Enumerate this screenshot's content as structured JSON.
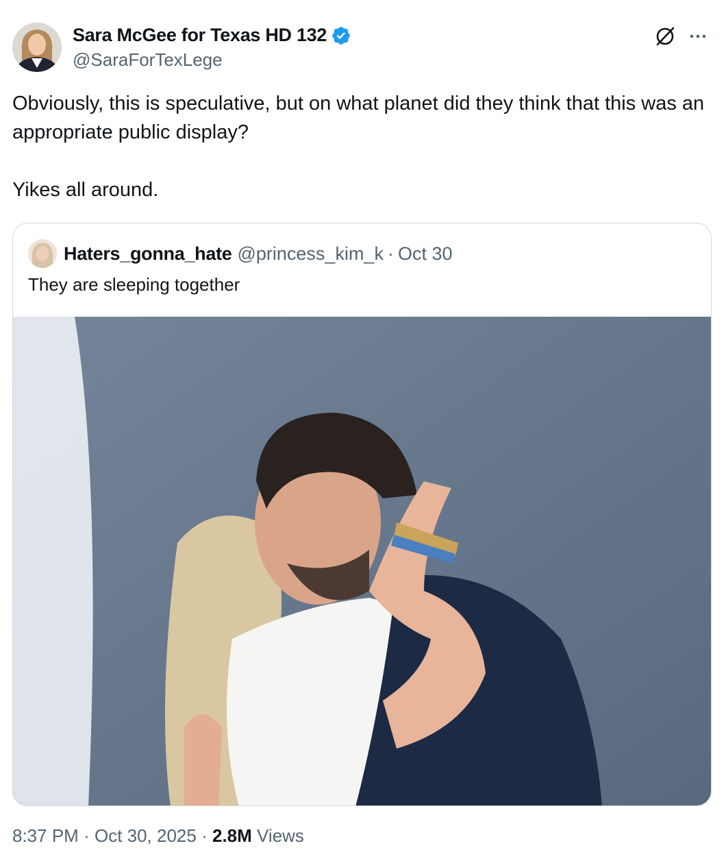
{
  "author": {
    "name": "Sara McGee for Texas HD 132",
    "handle": "@SaraForTexLege",
    "verified": true,
    "verified_color": "#1d9bf0"
  },
  "post": {
    "paragraphs": [
      "Obviously, this is speculative, but on what planet did they think that this was an appropriate public display?",
      "Yikes all around."
    ]
  },
  "quoted_post": {
    "name": "Haters_gonna_hate",
    "handle": "@princess_kim_k",
    "separator": "·",
    "date": "Oct 30",
    "text": "They are sleeping together",
    "media": {
      "icon": "photo-image"
    }
  },
  "meta": {
    "time": "8:37 PM",
    "date": "Oct 30, 2025",
    "separator": "·",
    "views_count": "2.8M",
    "views_label": "Views"
  },
  "icons": {
    "grok": "grok-icon",
    "more": "more-icon"
  },
  "colors": {
    "text_primary": "#0f1419",
    "text_secondary": "#536471",
    "border": "#cfd9de"
  }
}
